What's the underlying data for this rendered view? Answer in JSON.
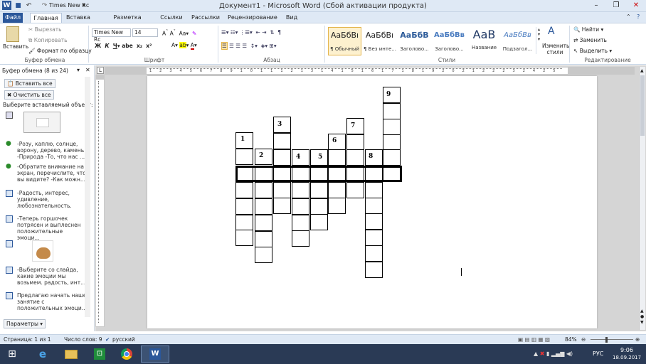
{
  "window": {
    "title": "Документ1 - Microsoft Word (Сбой активации продукта)",
    "font_box": "Times New Rc"
  },
  "tabs": [
    "Файл",
    "Главная",
    "Вставка",
    "Разметка страницы",
    "Ссылки",
    "Рассылки",
    "Рецензирование",
    "Вид"
  ],
  "ribbon": {
    "paste": "Вставить",
    "cut": "Вырезать",
    "copy": "Копировать",
    "format": "Формат по образцу",
    "clipboard_label": "Буфер обмена",
    "font_name": "Times New Rc",
    "font_size": "14",
    "font_label": "Шрифт",
    "para_label": "Абзац",
    "styles": [
      {
        "preview": "АаБбВı",
        "name": "¶ Обычный"
      },
      {
        "preview": "АаБбВı",
        "name": "¶ Без инте..."
      },
      {
        "preview": "АаБбВ",
        "name": "Заголово..."
      },
      {
        "preview": "АаБбВв",
        "name": "Заголово..."
      },
      {
        "preview": "АаВ",
        "name": "Название"
      },
      {
        "preview": "АаБбВв",
        "name": "Подзагол..."
      }
    ],
    "change_styles": "Изменить стили",
    "styles_label": "Стили",
    "find": "Найти",
    "replace": "Заменить",
    "select": "Выделить",
    "edit_label": "Редактирование"
  },
  "clipboard_pane": {
    "title": "Буфер обмена (8 из 24)",
    "paste_all": "Вставить все",
    "clear_all": "Очистить все",
    "hint": "Выберите вставляемый объект:",
    "items": [
      "-Розу, каплю, солнце, ворону, дерево, камень -Природа -То, что нас ...",
      "-Обратите внимание на экран, перечислите, что вы видите? -Как можн...",
      "-Радость, интерес, удивление, любознательность.",
      "-Теперь горшочек потрясен и выплеснен положительные эмоци...",
      "-Выберите со слайда, какие эмоции мы возьмем. радость, инт...",
      "Предлагаю начать наше занятие с положительных эмоци..."
    ],
    "options": "Параметры"
  },
  "crossword": {
    "numbers": [
      "1",
      "2",
      "3",
      "4",
      "5",
      "6",
      "7",
      "8",
      "9"
    ]
  },
  "status": {
    "page": "Страница: 1 из 1",
    "words": "Число слов: 9",
    "lang": "русский",
    "zoom": "84%"
  },
  "taskbar": {
    "lang": "РУС",
    "time": "9:06",
    "date": "18.09.2017"
  }
}
